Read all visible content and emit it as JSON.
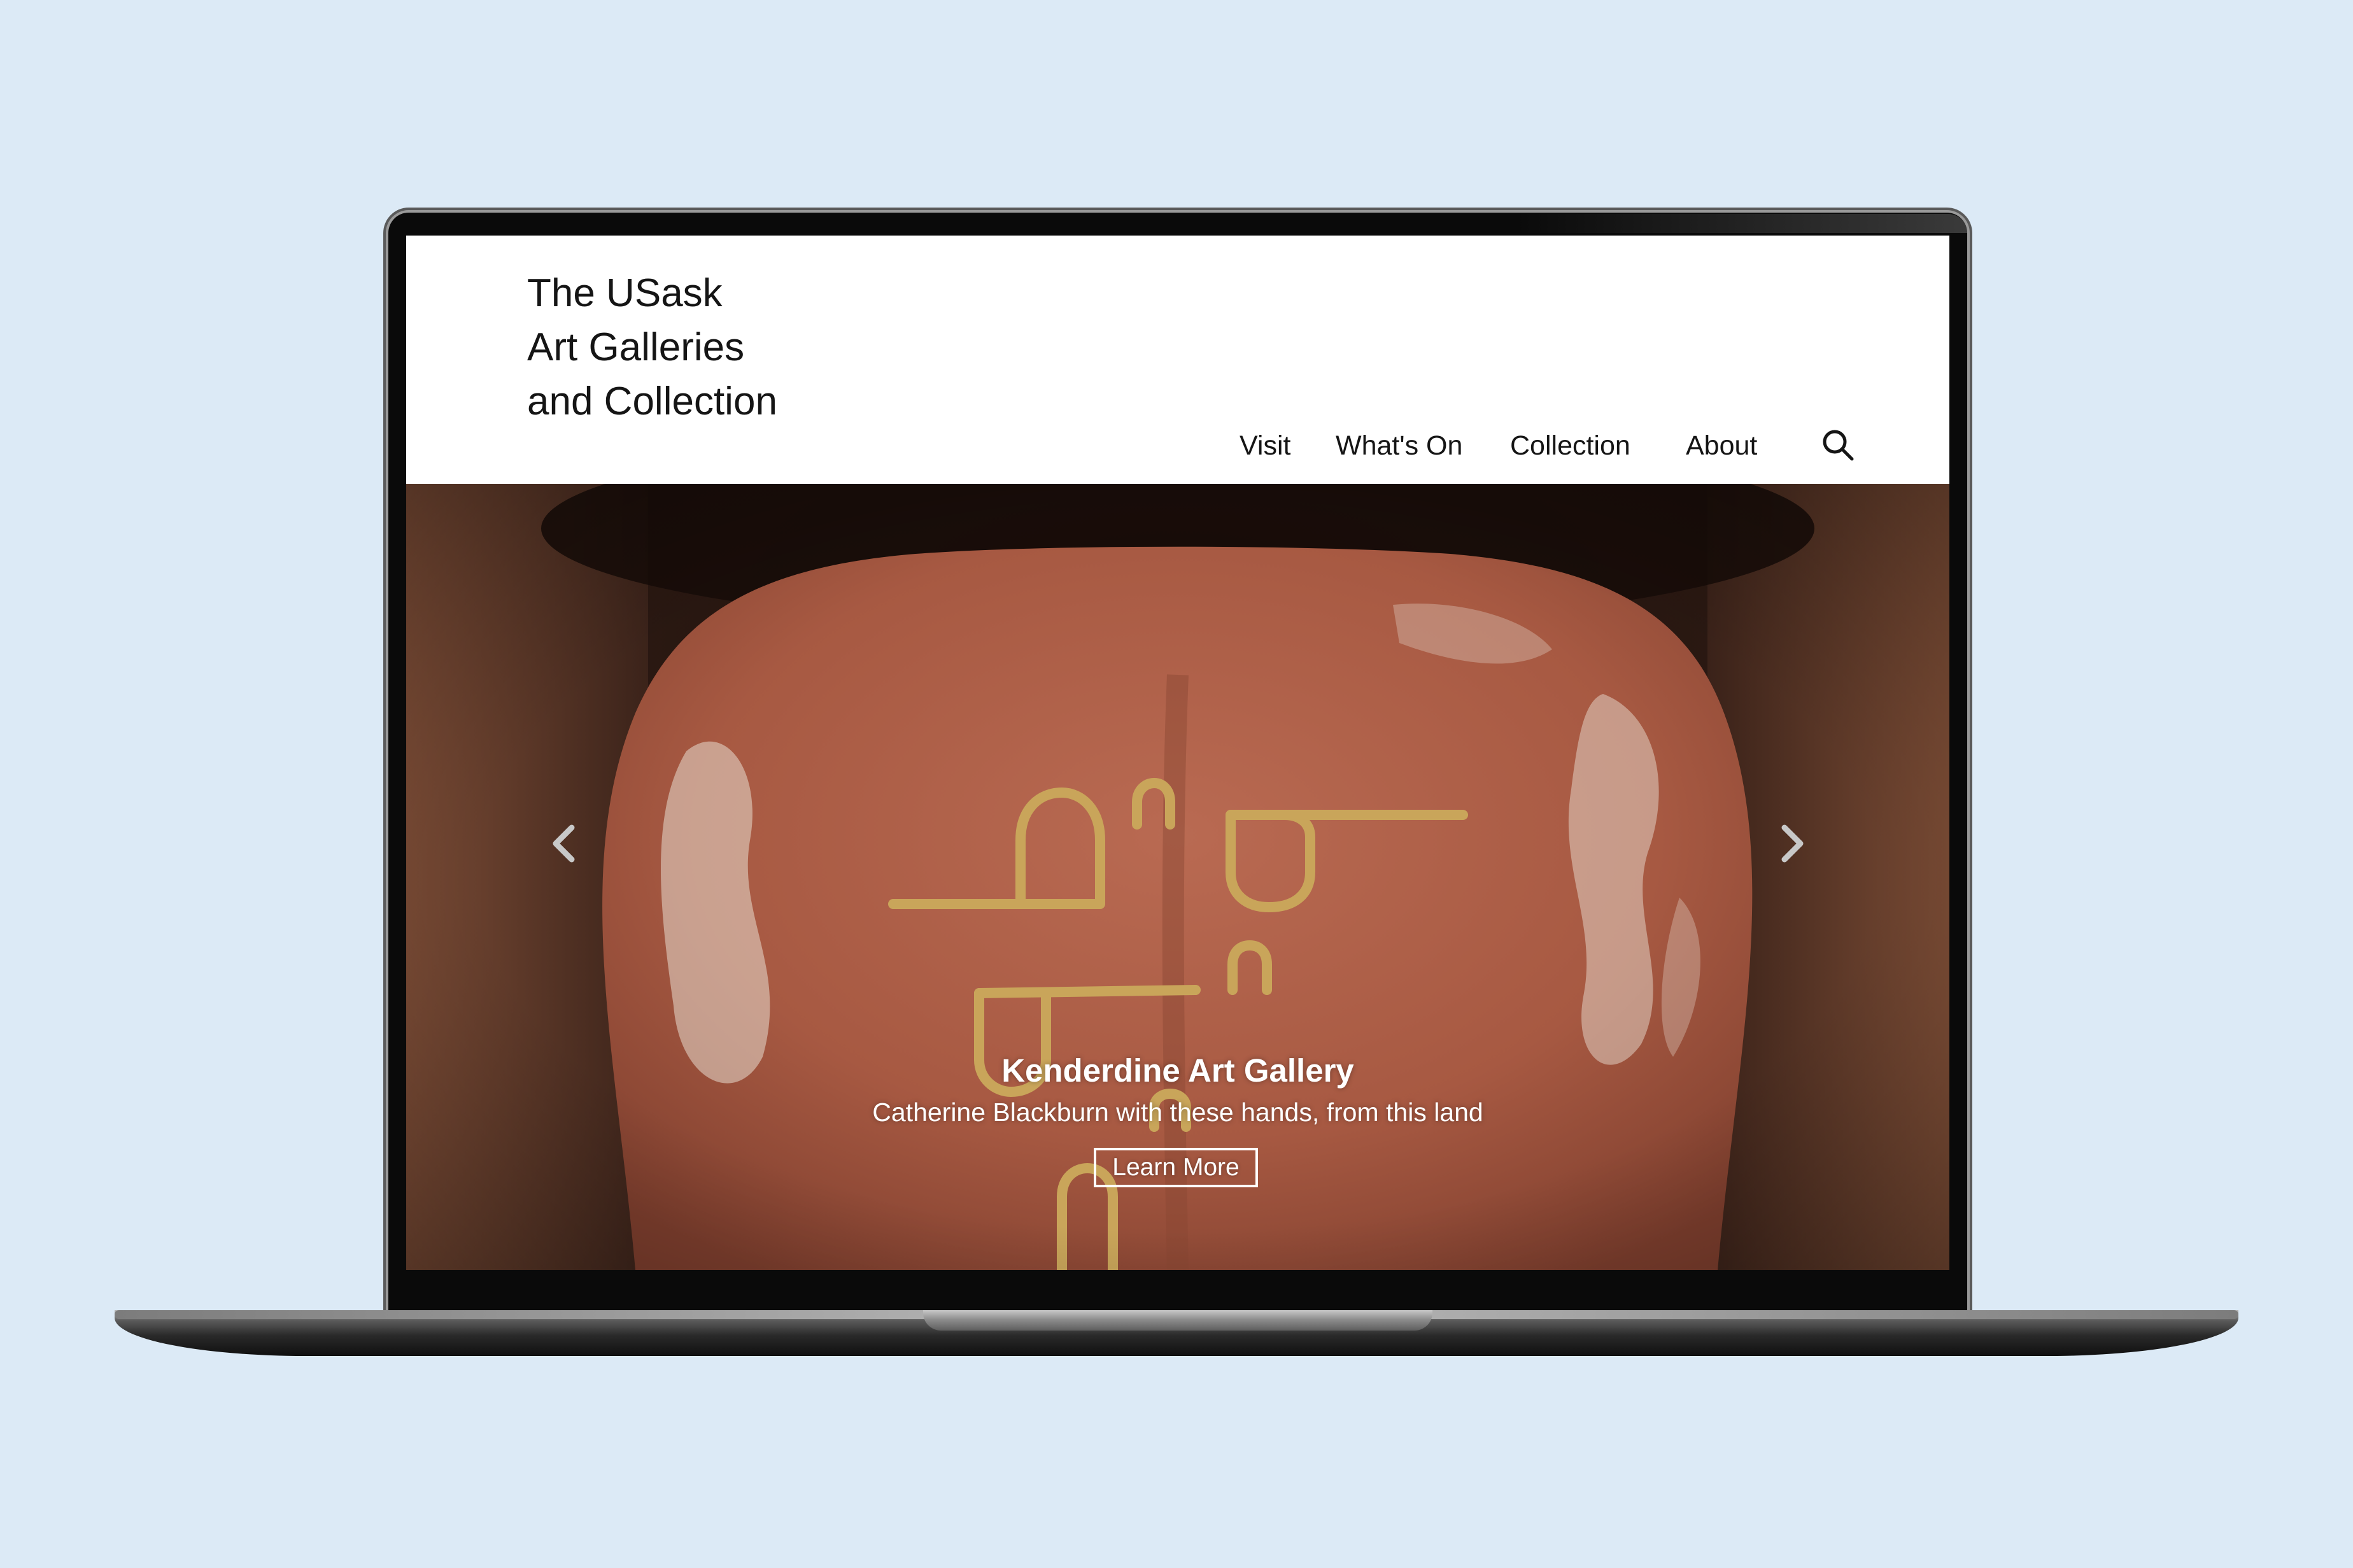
{
  "site": {
    "logo_lines": [
      "The USask",
      "Art Galleries",
      "and Collection"
    ]
  },
  "nav": {
    "items": [
      "Visit",
      "What's On",
      "Collection",
      "About"
    ],
    "search_icon": "search-icon"
  },
  "hero": {
    "title": "Kenderdine Art Gallery",
    "subtitle": "Catherine Blackburn with these hands, from this land",
    "button_label": "Learn More",
    "prev_icon": "chevron-left-icon",
    "next_icon": "chevron-right-icon"
  },
  "colors": {
    "page_background": "#dceaf6",
    "header_background": "#ffffff",
    "text": "#151515",
    "hero_text": "#ffffff",
    "beadwork": "#c9a55a"
  }
}
